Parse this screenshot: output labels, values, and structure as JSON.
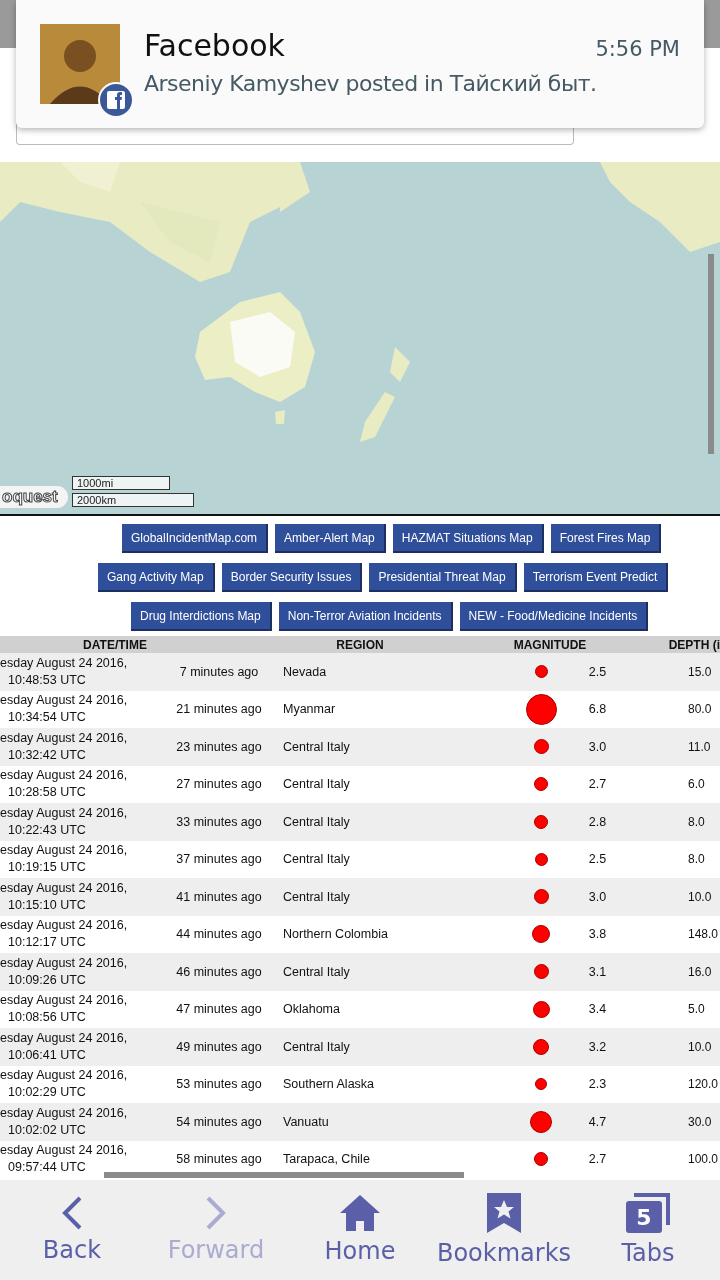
{
  "notification": {
    "app": "Facebook",
    "time": "5:56 PM",
    "message": "Arseniy Kamyshev posted in Тайский быт."
  },
  "map": {
    "logo": "oquest",
    "scale": [
      "1000mi",
      "2000km"
    ]
  },
  "link_rows": [
    {
      "buttons": [
        "GlobalIncidentMap.com",
        "Amber-Alert Map",
        "HAZMAT Situations Map",
        "Forest Fires Map"
      ]
    },
    {
      "buttons": [
        "Gang Activity Map",
        "Border Security Issues",
        "Presidential Threat Map",
        "Terrorism Event Predict"
      ]
    },
    {
      "buttons": [
        "Drug Interdictions Map",
        "Non-Terror Aviation Incidents",
        "NEW - Food/Medicine Incidents"
      ]
    }
  ],
  "table": {
    "columns": [
      "DATE/TIME",
      "REGION",
      "MAGNITUDE",
      "DEPTH (i"
    ],
    "rows": [
      {
        "date": "esday August 24 2016,",
        "time": "10:48:53 UTC",
        "ago": "7 minutes ago",
        "region": "Nevada",
        "magnitude": "2.5",
        "depth": "15.0"
      },
      {
        "date": "esday August 24 2016,",
        "time": "10:34:54 UTC",
        "ago": "21 minutes ago",
        "region": "Myanmar",
        "magnitude": "6.8",
        "depth": "80.0"
      },
      {
        "date": "esday August 24 2016,",
        "time": "10:32:42 UTC",
        "ago": "23 minutes ago",
        "region": "Central Italy",
        "magnitude": "3.0",
        "depth": "11.0"
      },
      {
        "date": "esday August 24 2016,",
        "time": "10:28:58 UTC",
        "ago": "27 minutes ago",
        "region": "Central Italy",
        "magnitude": "2.7",
        "depth": "6.0"
      },
      {
        "date": "esday August 24 2016,",
        "time": "10:22:43 UTC",
        "ago": "33 minutes ago",
        "region": "Central Italy",
        "magnitude": "2.8",
        "depth": "8.0"
      },
      {
        "date": "esday August 24 2016,",
        "time": "10:19:15 UTC",
        "ago": "37 minutes ago",
        "region": "Central Italy",
        "magnitude": "2.5",
        "depth": "8.0"
      },
      {
        "date": "esday August 24 2016,",
        "time": "10:15:10 UTC",
        "ago": "41 minutes ago",
        "region": "Central Italy",
        "magnitude": "3.0",
        "depth": "10.0"
      },
      {
        "date": "esday August 24 2016,",
        "time": "10:12:17 UTC",
        "ago": "44 minutes ago",
        "region": "Northern Colombia",
        "magnitude": "3.8",
        "depth": "148.0"
      },
      {
        "date": "esday August 24 2016,",
        "time": "10:09:26 UTC",
        "ago": "46 minutes ago",
        "region": "Central Italy",
        "magnitude": "3.1",
        "depth": "16.0"
      },
      {
        "date": "esday August 24 2016,",
        "time": "10:08:56 UTC",
        "ago": "47 minutes ago",
        "region": "Oklahoma",
        "magnitude": "3.4",
        "depth": "5.0"
      },
      {
        "date": "esday August 24 2016,",
        "time": "10:06:41 UTC",
        "ago": "49 minutes ago",
        "region": "Central Italy",
        "magnitude": "3.2",
        "depth": "10.0"
      },
      {
        "date": "esday August 24 2016,",
        "time": "10:02:29 UTC",
        "ago": "53 minutes ago",
        "region": "Southern Alaska",
        "magnitude": "2.3",
        "depth": "120.0"
      },
      {
        "date": "esday August 24 2016,",
        "time": "10:02:02 UTC",
        "ago": "54 minutes ago",
        "region": "Vanuatu",
        "magnitude": "4.7",
        "depth": "30.0"
      },
      {
        "date": "esday August 24 2016,",
        "time": "09:57:44 UTC",
        "ago": "58 minutes ago",
        "region": "Tarapaca, Chile",
        "magnitude": "2.7",
        "depth": "100.0"
      }
    ]
  },
  "nav": [
    {
      "kind": "back",
      "label": "Back",
      "disabled": false
    },
    {
      "kind": "forward",
      "label": "Forward",
      "disabled": true
    },
    {
      "kind": "home",
      "label": "Home",
      "disabled": false
    },
    {
      "kind": "bookmarks",
      "label": "Bookmarks",
      "disabled": false
    },
    {
      "kind": "tabs",
      "label": "Tabs",
      "disabled": false,
      "count": "5"
    }
  ]
}
